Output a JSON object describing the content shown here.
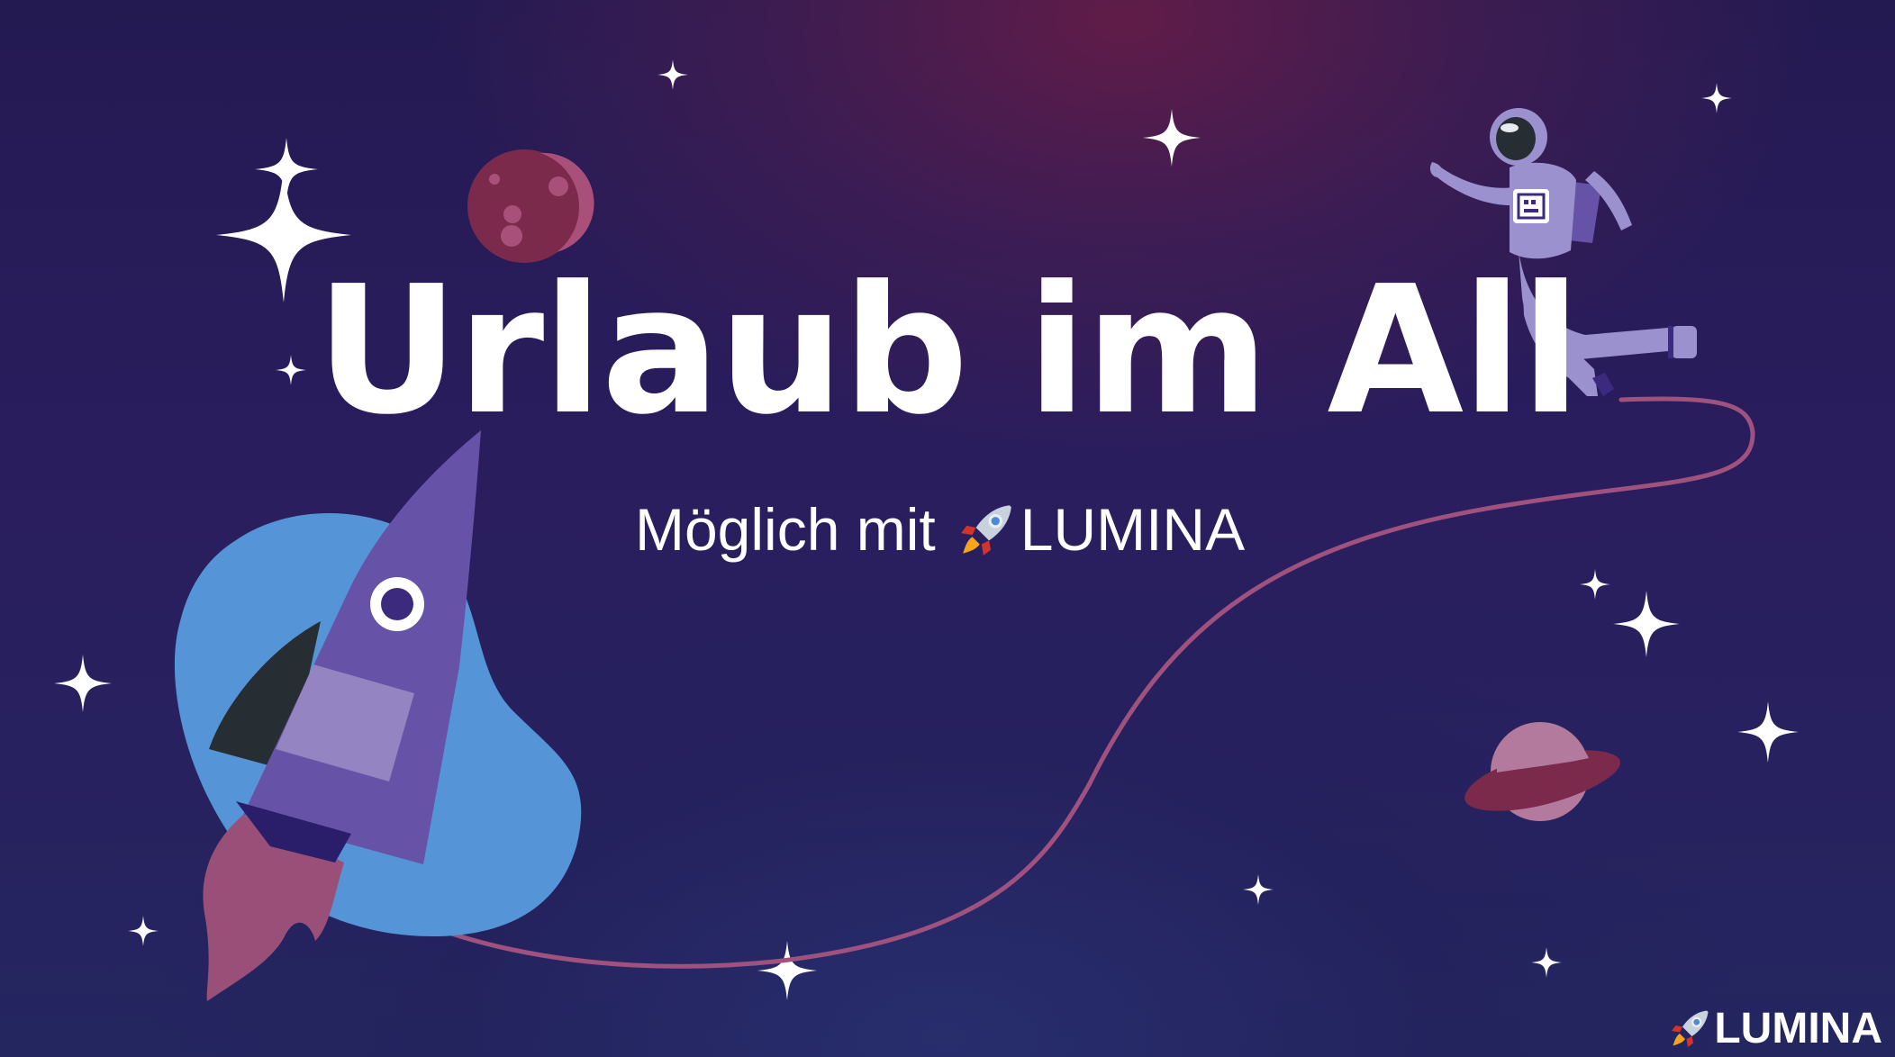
{
  "title": "Urlaub im All",
  "subtitle": {
    "prefix": "Möglich mit",
    "icon": "rocket-emoji",
    "brand": "LUMINA"
  },
  "logo": {
    "icon": "rocket-emoji",
    "text": "LUMINA"
  },
  "colors": {
    "background_top": "#2a1d5e",
    "background_glow": "#641c48",
    "rocket_body": "#6652a6",
    "rocket_band": "#9584c2",
    "rocket_fin": "#262d33",
    "rocket_flame": "#9a4f78",
    "blob": "#5594d6",
    "tether": "#a0527e",
    "planet_moon": "#7b2a4c",
    "planet_ringed": "#b47a9e",
    "astronaut_suit": "#9c91cf",
    "star": "#ffffff"
  }
}
